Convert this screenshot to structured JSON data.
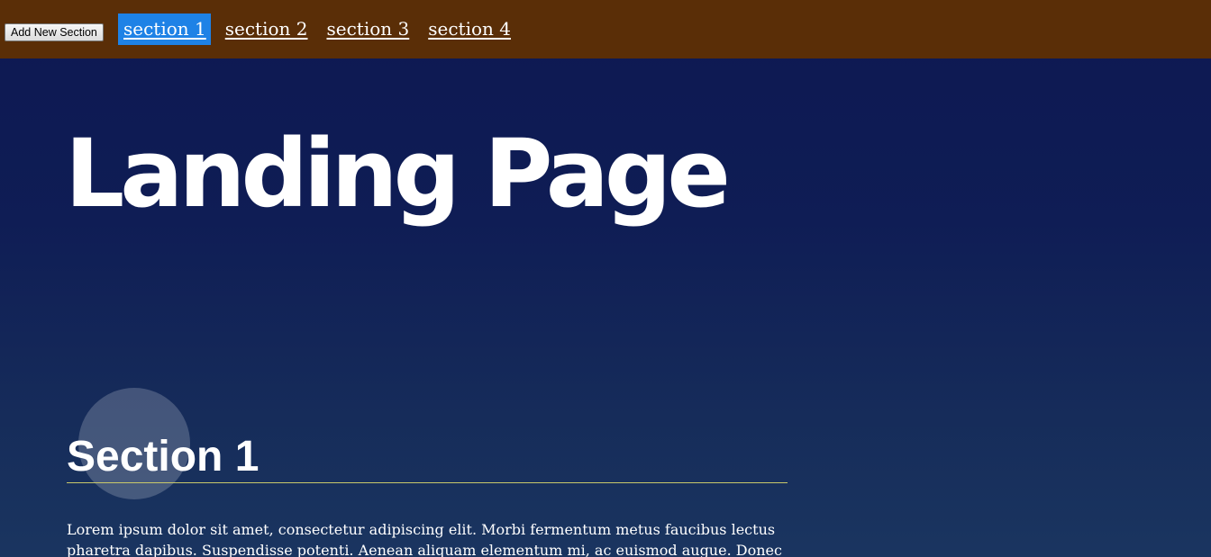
{
  "navbar": {
    "add_button_label": "Add New Section",
    "items": [
      {
        "label": "section 1",
        "active": true
      },
      {
        "label": "section 2",
        "active": false
      },
      {
        "label": "section 3",
        "active": false
      },
      {
        "label": "section 4",
        "active": false
      }
    ]
  },
  "hero": {
    "title": "Landing Page"
  },
  "sections": [
    {
      "heading": "Section 1",
      "text": "Lorem ipsum dolor sit amet, consectetur adipiscing elit. Morbi fermentum metus faucibus lectus pharetra dapibus. Suspendisse potenti. Aenean aliquam elementum mi, ac euismod augue. Donec eget"
    }
  ],
  "colors": {
    "navbar_bg": "#5a2e07",
    "active_nav_bg": "#1e82e6",
    "page_bg": "#0f1d55",
    "heading_underline": "#c9c96a"
  }
}
